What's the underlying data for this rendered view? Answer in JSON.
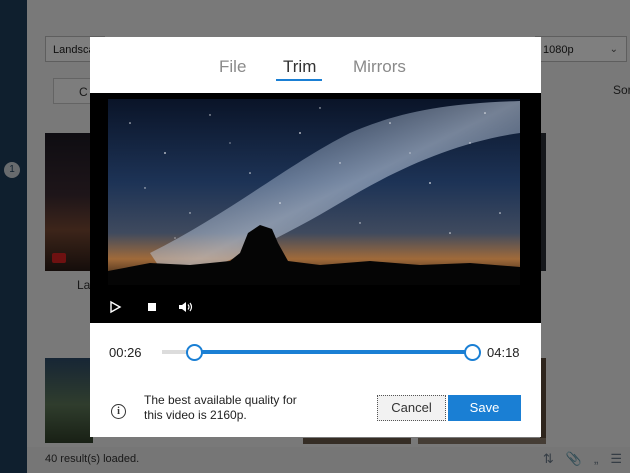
{
  "background": {
    "rail_badge": "1",
    "select_left_value": "Landsca",
    "select_right_value": "1080p",
    "button_label": "C",
    "sort_label": "Sor",
    "thumb_caption": "La",
    "status": "40 result(s) loaded."
  },
  "dialog": {
    "tabs": [
      {
        "label": "File",
        "active": false
      },
      {
        "label": "Trim",
        "active": true
      },
      {
        "label": "Mirrors",
        "active": false
      }
    ],
    "player": {
      "controls": [
        "play-icon",
        "stop-icon",
        "volume-icon"
      ]
    },
    "trim": {
      "start_time": "00:26",
      "end_time": "04:18",
      "start_fraction": 0.104,
      "end_fraction": 1.0
    },
    "info_text": "The best available quality for this video is 2160p.",
    "cancel_label": "Cancel",
    "save_label": "Save"
  },
  "colors": {
    "accent": "#1a7fd4",
    "rail": "#1e3e5c"
  }
}
